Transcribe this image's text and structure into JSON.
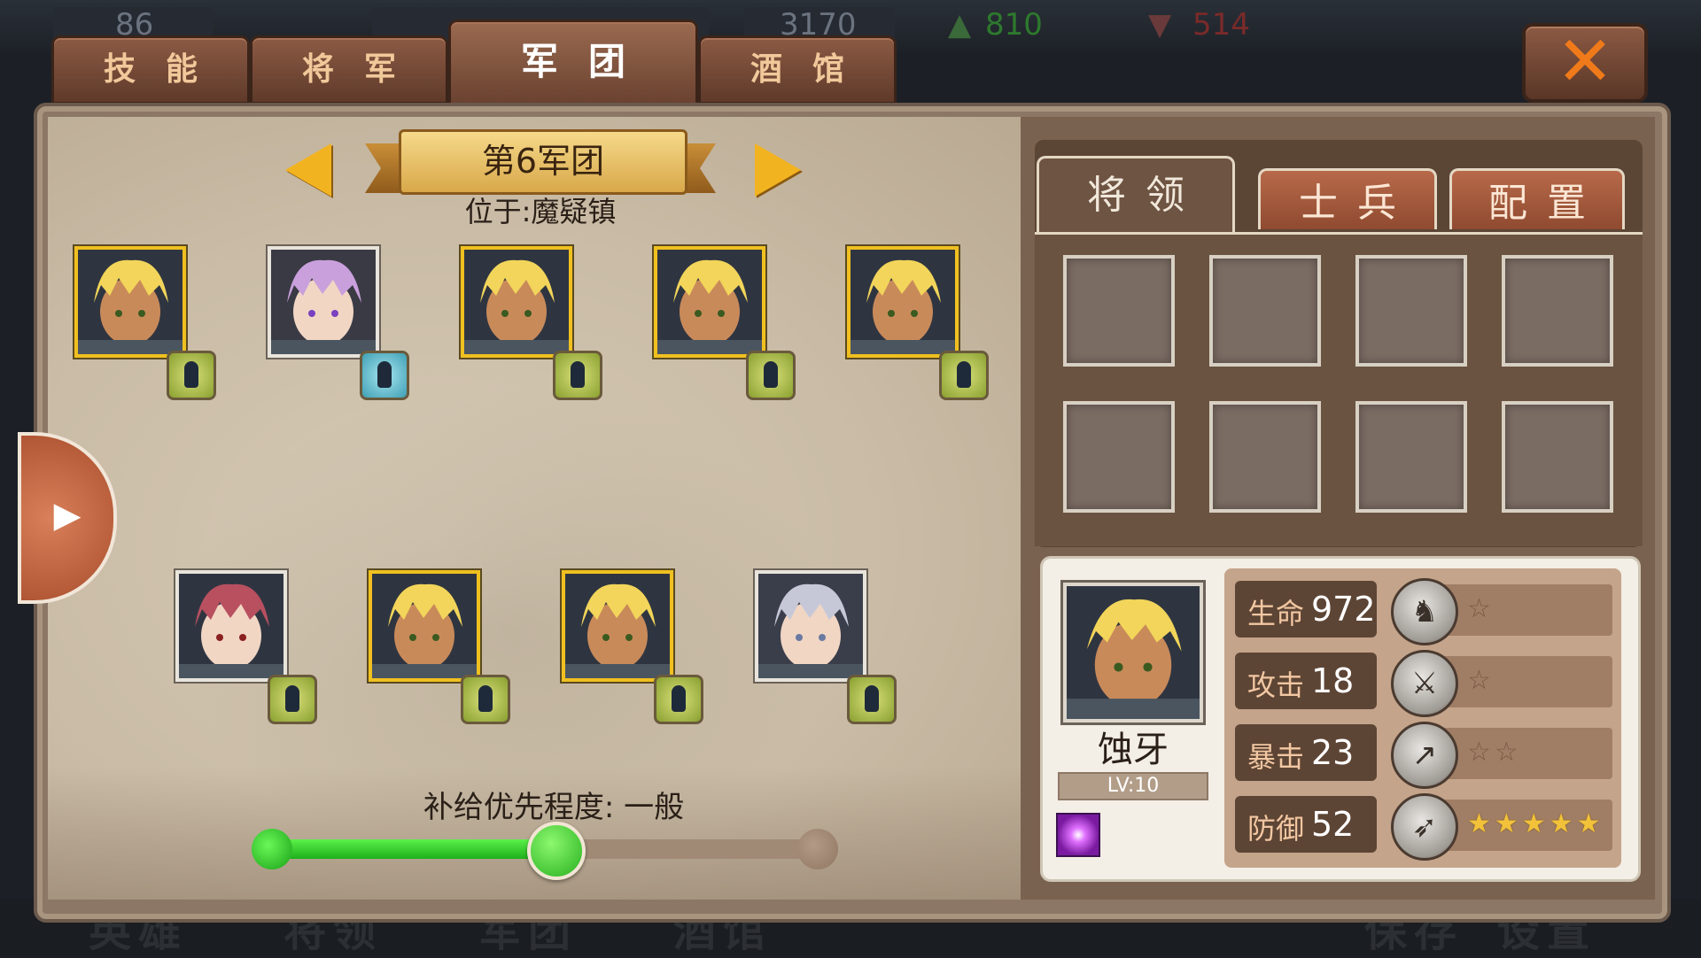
{
  "status": {
    "val1": "86",
    "val2": "3170",
    "val3": "810",
    "val4": "514"
  },
  "tabs": [
    {
      "label": "技能"
    },
    {
      "label": "将军"
    },
    {
      "label": "军团"
    },
    {
      "label": "酒馆"
    }
  ],
  "active_tab": "军团",
  "close_label": "✕",
  "legion": {
    "title": "第6军团",
    "location": "位于:魔疑镇"
  },
  "heroes_top": [
    {
      "type": "blond",
      "badge": "green"
    },
    {
      "type": "pink-girl",
      "badge": "blue"
    },
    {
      "type": "blond",
      "badge": "green"
    },
    {
      "type": "blond",
      "badge": "green"
    },
    {
      "type": "blond",
      "badge": "green"
    }
  ],
  "heroes_bottom": [
    {
      "type": "red-hair",
      "badge": "green"
    },
    {
      "type": "blond",
      "badge": "green"
    },
    {
      "type": "blond",
      "badge": "green"
    },
    {
      "type": "silver-hair",
      "badge": "green"
    }
  ],
  "supply": {
    "label": "补给优先程度: 一般",
    "level": 0.5
  },
  "right_tabs": [
    {
      "label": "将领"
    },
    {
      "label": "士兵"
    },
    {
      "label": "配置"
    }
  ],
  "slot_count": 8,
  "selected_hero": {
    "name": "蚀牙",
    "level": "LV:10",
    "stats": [
      {
        "label": "生命",
        "value": "972",
        "icon": "horse-icon",
        "stars": "☆",
        "gold": false
      },
      {
        "label": "攻击",
        "value": "18",
        "icon": "sword-icon",
        "stars": "☆",
        "gold": false
      },
      {
        "label": "暴击",
        "value": "23",
        "icon": "spear-icon",
        "stars": "☆☆",
        "gold": false
      },
      {
        "label": "防御",
        "value": "52",
        "icon": "bow-icon",
        "stars": "★★★★★",
        "gold": true
      }
    ]
  },
  "ghost_footer": [
    "英雄",
    "将领",
    "军团",
    "酒馆",
    "保存",
    "设置"
  ]
}
